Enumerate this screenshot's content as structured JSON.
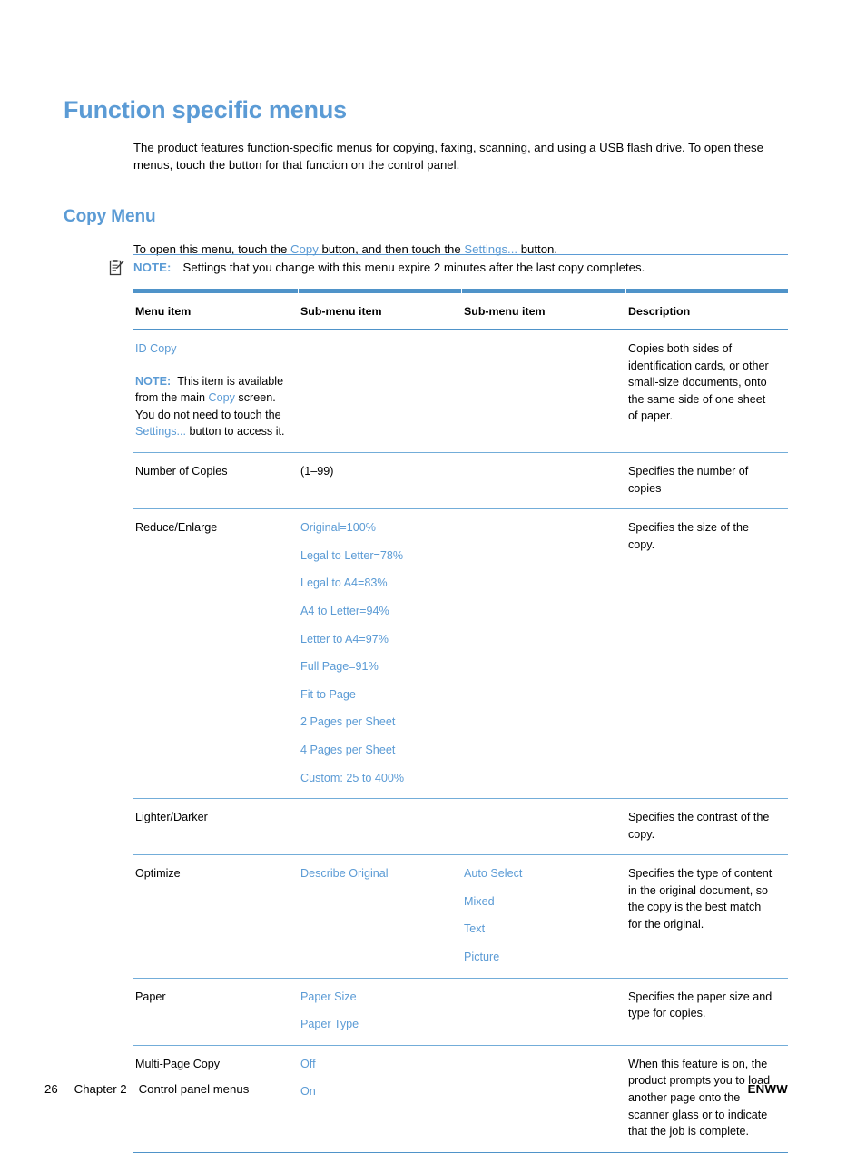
{
  "page": {
    "heading": "Function specific menus",
    "intro_paragraph": "The product features function-specific menus for copying, faxing, scanning, and using a USB flash drive. To open these menus, touch the button for that function on the control panel.",
    "section_heading": "Copy Menu",
    "section_intro": {
      "part1": "To open this menu, touch the ",
      "term1": "Copy",
      "part2": " button, and then touch the ",
      "term2": "Settings...",
      "part3": " button."
    },
    "note": {
      "icon": "note-clipboard-icon",
      "label": "NOTE:",
      "text": "Settings that you change with this menu expire 2 minutes after the last copy completes."
    }
  },
  "colors": {
    "heading_blue": "#5b9bd5",
    "rule_blue": "#4f93c9",
    "row_rule_blue": "#73add9",
    "body_black": "#000000"
  },
  "table": {
    "headers": [
      "Menu item",
      "Sub-menu item",
      "Sub-menu item",
      "Description"
    ],
    "rows": [
      {
        "menu_item": "ID Copy",
        "menu_item_note": {
          "label": "NOTE:",
          "text_a": "This item is available from the main ",
          "term_a": "Copy",
          "text_b": " screen. You do not need to touch the ",
          "term_b": "Settings...",
          "text_c": " button to access it."
        },
        "sub1": [],
        "sub2": [],
        "description": "Copies both sides of identification cards, or other small-size documents, onto the same side of one sheet of paper."
      },
      {
        "menu_item": "Number of Copies",
        "sub1_plain": "(1–99)",
        "sub1": [],
        "sub2": [],
        "description": "Specifies the number of copies"
      },
      {
        "menu_item": "Reduce/Enlarge",
        "sub1": [
          "Original=100%",
          "Legal to Letter=78%",
          "Legal to A4=83%",
          "A4 to Letter=94%",
          "Letter to A4=97%",
          "Full Page=91%",
          "Fit to Page",
          "2 Pages per Sheet",
          "4 Pages per Sheet",
          "Custom: 25 to 400%"
        ],
        "sub2": [],
        "description": "Specifies the size of the copy."
      },
      {
        "menu_item": "Lighter/Darker",
        "sub1": [],
        "sub2": [],
        "description": "Specifies the contrast of the copy."
      },
      {
        "menu_item": "Optimize",
        "sub1": [
          "Describe Original"
        ],
        "sub2": [
          "Auto Select",
          "Mixed",
          "Text",
          "Picture"
        ],
        "description": "Specifies the type of content in the original document, so the copy is the best match for the original."
      },
      {
        "menu_item": "Paper",
        "sub1": [
          "Paper Size",
          "Paper Type"
        ],
        "sub2": [],
        "description": "Specifies the paper size and type for copies."
      },
      {
        "menu_item": "Multi-Page Copy",
        "sub1": [
          "Off",
          "On"
        ],
        "sub2": [],
        "description": "When this feature is on, the product prompts you to load another page onto the scanner glass or to indicate that the job is complete."
      }
    ]
  },
  "footer": {
    "page_number": "26",
    "chapter": "Chapter 2",
    "chapter_title": "Control panel menus",
    "right_label": "ENWW"
  }
}
